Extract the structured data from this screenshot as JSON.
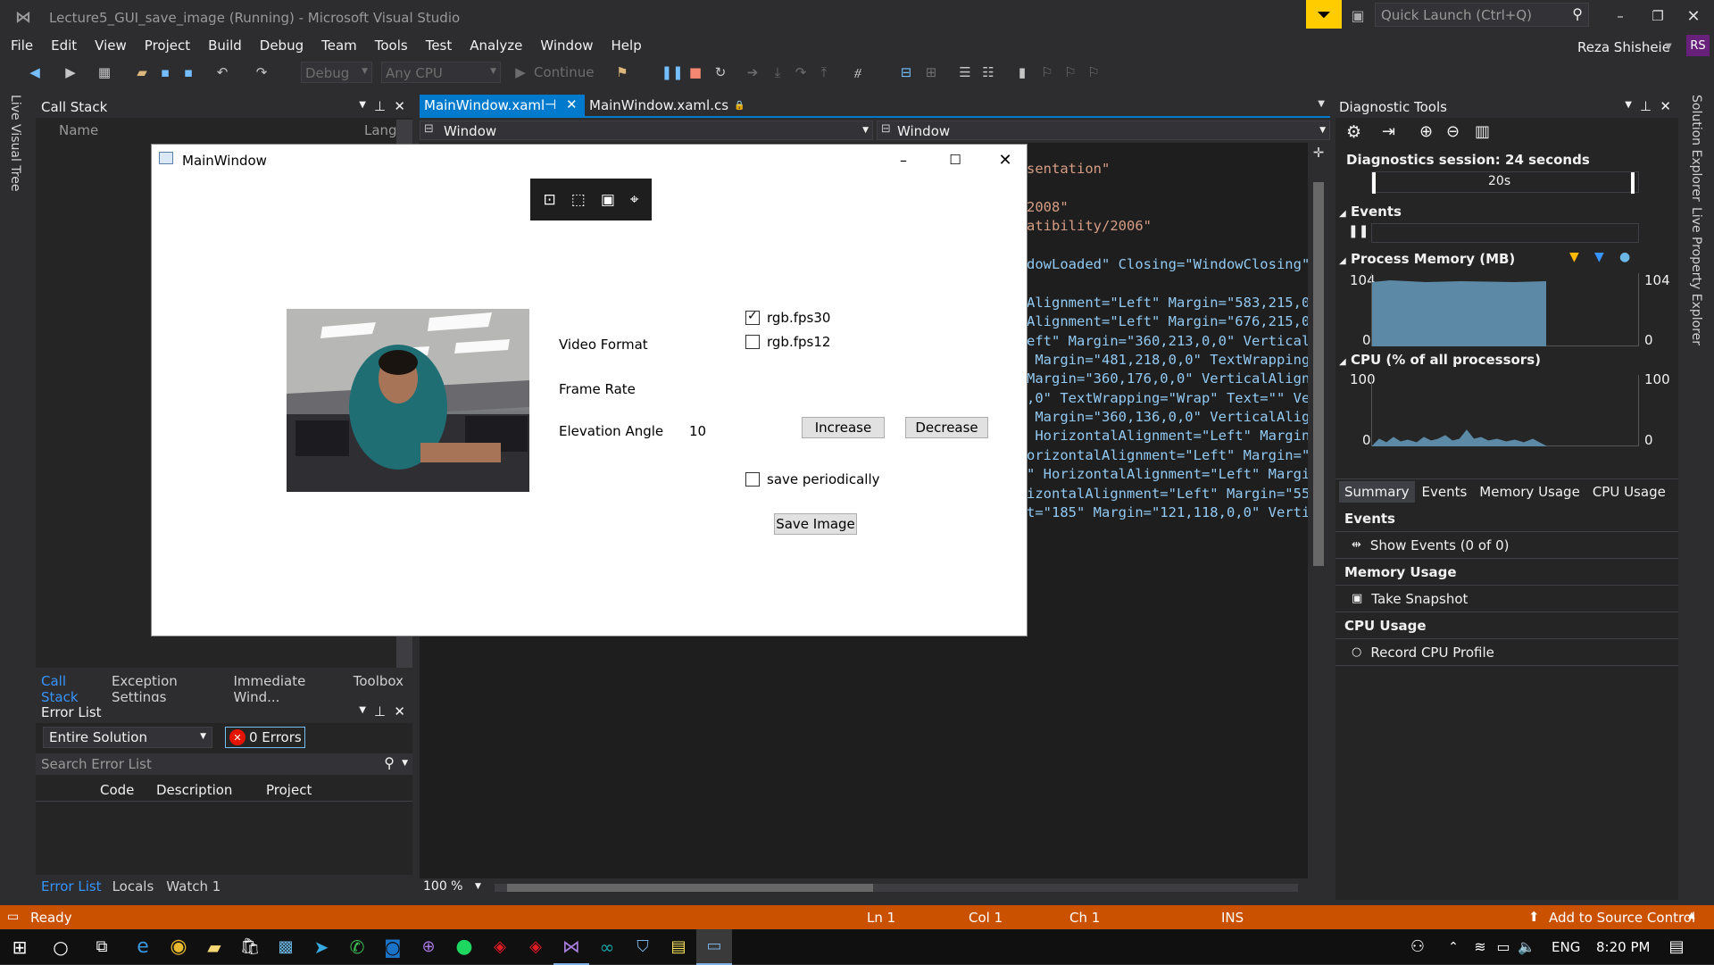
{
  "title": "Lecture5_GUI_save_image (Running) - Microsoft Visual Studio",
  "quick_launch_placeholder": "Quick Launch (Ctrl+Q)",
  "user": {
    "name": "Reza Shisheie",
    "initials": "RS"
  },
  "menu": [
    "File",
    "Edit",
    "View",
    "Project",
    "Build",
    "Debug",
    "Team",
    "Tools",
    "Test",
    "Analyze",
    "Window",
    "Help"
  ],
  "toolbar": {
    "config": "Debug",
    "platform": "Any CPU",
    "continue_label": "Continue"
  },
  "left_strip_label": "Live Visual Tree",
  "call_stack": {
    "title": "Call Stack",
    "col_name": "Name",
    "col_lang": "Lang"
  },
  "left_tabs": [
    "Call Stack",
    "Exception Settings",
    "Immediate Wind...",
    "Toolbox"
  ],
  "error_list": {
    "title": "Error List",
    "scope": "Entire Solution",
    "errors_label": "0 Errors",
    "search_placeholder": "Search Error List",
    "cols": [
      "Code",
      "Description",
      "Project"
    ]
  },
  "bottom_tabs": [
    "Error List",
    "Locals",
    "Watch 1"
  ],
  "editor": {
    "tabs": [
      {
        "label": "MainWindow.xaml"
      },
      {
        "label": "MainWindow.xaml.cs"
      }
    ],
    "nav_left": "Window",
    "nav_right": "Window",
    "zoom": "100 %",
    "code_lines": [
      {
        "t": "sentation\"",
        "c": "s"
      },
      {
        "t": "",
        "c": ""
      },
      {
        "t": "2008\"",
        "c": "s"
      },
      {
        "t": "atibility/2006\"",
        "c": "s"
      },
      {
        "t": "",
        "c": ""
      },
      {
        "t": "dowLoaded\" Closing=\"WindowClosing\">",
        "c": "m"
      },
      {
        "t": "",
        "c": ""
      },
      {
        "t": "Alignment=\"Left\" Margin=\"583,215,0,",
        "c": "m"
      },
      {
        "t": "Alignment=\"Left\" Margin=\"676,215,0,",
        "c": "m"
      },
      {
        "t": "eft\" Margin=\"360,213,0,0\" VerticalA",
        "c": "m"
      },
      {
        "t": " Margin=\"481,218,0,0\" TextWrapping=",
        "c": "m"
      },
      {
        "t": "Margin=\"360,176,0,0\" VerticalAlignm",
        "c": "m"
      },
      {
        "t": ",0\" TextWrapping=\"Wrap\" Text=\"\" Ver",
        "c": "m"
      },
      {
        "t": " Margin=\"360,136,0,0\" VerticalAlig",
        "c": "m"
      },
      {
        "t": " HorizontalAlignment=\"Left\" Margin=",
        "c": "m"
      },
      {
        "t": "orizontalAlignment=\"Left\" Margin=\"5",
        "c": "m"
      },
      {
        "t": "\" HorizontalAlignment=\"Left\" Margi",
        "c": "m"
      },
      {
        "t": "izontalAlignment=\"Left\" Margin=\"558",
        "c": "m"
      },
      {
        "t": "t=\"185\" Margin=\"121,118,0,0\" Vertic",
        "c": "m"
      }
    ]
  },
  "app_window": {
    "title": "MainWindow",
    "labels": {
      "video_format": "Video Format",
      "frame_rate": "Frame Rate",
      "elevation": "Elevation Angle",
      "elevation_value": "10"
    },
    "checkboxes": [
      {
        "label": "rgb.fps30",
        "checked": true
      },
      {
        "label": "rgb.fps12",
        "checked": false
      }
    ],
    "buttons": {
      "increase": "Increase",
      "decrease": "Decrease",
      "save": "Save Image"
    },
    "save_periodically": {
      "label": "save periodically",
      "checked": false
    }
  },
  "diagnostic": {
    "title": "Diagnostic Tools",
    "session": "Diagnostics session: 24 seconds",
    "timeline_tick": "20s",
    "events_label": "Events",
    "memory_label": "Process Memory (MB)",
    "memory_max": "104",
    "memory_min": "0",
    "cpu_label": "CPU (% of all processors)",
    "cpu_max": "100",
    "cpu_min": "0",
    "tabs": [
      "Summary",
      "Events",
      "Memory Usage",
      "CPU Usage"
    ],
    "sections": [
      {
        "head": "Events",
        "action": "Show Events (0 of 0)"
      },
      {
        "head": "Memory Usage",
        "action": "Take Snapshot"
      },
      {
        "head": "CPU Usage",
        "action": "Record CPU Profile"
      }
    ]
  },
  "right_strip_labels": [
    "Solution Explorer",
    "Live Property Explorer"
  ],
  "status": {
    "ready": "Ready",
    "ln": "Ln 1",
    "col": "Col 1",
    "ch": "Ch 1",
    "ins": "INS",
    "source_control": "Add to Source Control"
  },
  "taskbar": {
    "lang": "ENG",
    "time": "8:20 PM"
  },
  "colors": {
    "vs_bg": "#2d2d30",
    "accent": "#007acc",
    "status_bar": "#ca5100",
    "vs_purple": "#68217a"
  }
}
